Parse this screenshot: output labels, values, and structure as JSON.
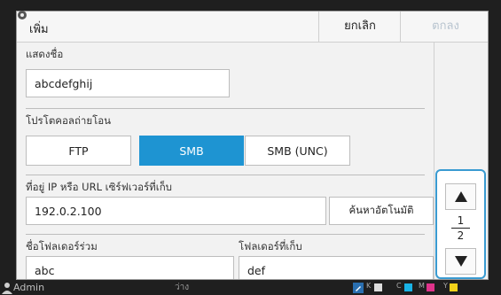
{
  "header": {
    "title": "เพิ่ม",
    "cancel_label": "ยกเลิก",
    "ok_label": "ตกลง"
  },
  "display_name": {
    "label": "แสดงชื่อ",
    "value": "abcdefghij"
  },
  "protocol": {
    "label": "โปรโตคอลถ่ายโอน",
    "options": [
      "FTP",
      "SMB",
      "SMB (UNC)"
    ],
    "selected": "SMB"
  },
  "server": {
    "label": "ที่อยู่ IP หรือ URL เซิร์ฟเวอร์ที่เก็บ",
    "value": "192.0.2.100",
    "auto_search_label": "ค้นหาอัตโนมัติ"
  },
  "shared_folder": {
    "label": "ชื่อโฟลเดอร์ร่วม",
    "value": "abc"
  },
  "storage_folder": {
    "label": "โฟลเดอร์ที่เก็บ",
    "value": "def"
  },
  "pager": {
    "current": "1",
    "total": "2"
  },
  "status_bar": {
    "user": "Admin",
    "status_text": "ว่าง",
    "inks": [
      "K",
      "C",
      "M",
      "Y"
    ]
  },
  "colors": {
    "accent": "#1e94d2",
    "focus_outline": "#3a9bd1",
    "disabled_text": "#b8c4cf"
  }
}
